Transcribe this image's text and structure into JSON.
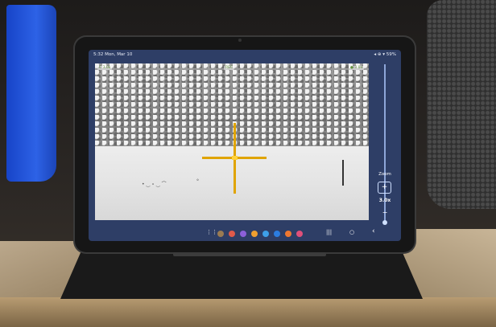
{
  "status_bar": {
    "time": "5:32  Mon, Mar 10",
    "right": "◂ ⊕ ▾ 59%"
  },
  "scope": {
    "indicator_top_left": "C 3.0x",
    "indicator_top_center": "REC",
    "indicator_top_right": "● 3.0x",
    "reticle_color": "#e0a400"
  },
  "zoom": {
    "label": "Zoom",
    "plus": "+",
    "value": "3.0x",
    "minus": "−",
    "level_fraction": 0.02
  },
  "navbar": {
    "grid_icon": "⋮⋮",
    "recents": "|||",
    "home": "○",
    "back": "‹",
    "apps": [
      {
        "name": "app-1",
        "color": "#9a7b52"
      },
      {
        "name": "app-2",
        "color": "#e05a4a"
      },
      {
        "name": "app-3",
        "color": "#8c60d8"
      },
      {
        "name": "app-4",
        "color": "#f0a030"
      },
      {
        "name": "app-5",
        "color": "#3ea0e8"
      },
      {
        "name": "app-6",
        "color": "#2c7de0"
      },
      {
        "name": "app-7",
        "color": "#f07830"
      },
      {
        "name": "app-8",
        "color": "#e0507a"
      }
    ]
  }
}
